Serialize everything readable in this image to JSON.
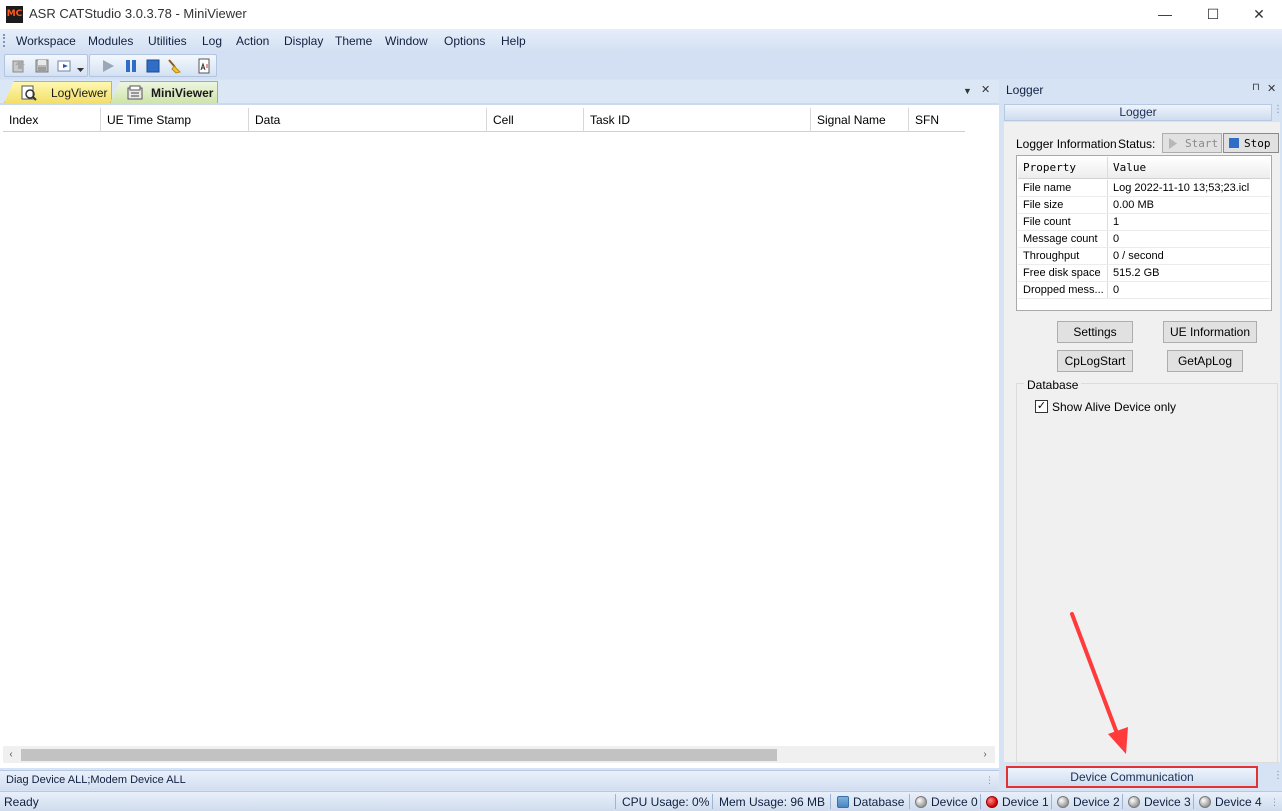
{
  "window": {
    "title": "ASR CATStudio 3.0.3.78 - MiniViewer",
    "logo_text": "MC",
    "minimize": "—",
    "maximize": "☐",
    "close": "✕"
  },
  "menu": {
    "items": [
      "Workspace",
      "Modules",
      "Utilities",
      "Log",
      "Action",
      "Display",
      "Theme",
      "Window",
      "Options",
      "Help"
    ]
  },
  "toolbar": {
    "icons": [
      "import-icon",
      "save-icon",
      "export-icon",
      "play-icon",
      "pause-icon",
      "stop-icon",
      "clear-icon",
      "report-icon"
    ]
  },
  "tabs": [
    {
      "label": "LogViewer",
      "active": false
    },
    {
      "label": "MiniViewer",
      "active": true
    }
  ],
  "pane_controls": {
    "dropdown": "▼",
    "close": "✕"
  },
  "grid": {
    "columns": [
      "Index",
      "UE Time Stamp",
      "Data",
      "Cell",
      "Task ID",
      "Signal Name",
      "SFN"
    ]
  },
  "scroll": {
    "left": "‹",
    "right": "›"
  },
  "status_line": "Diag Device ALL;Modem Device ALL",
  "logger": {
    "title": "Logger",
    "pin": "⊓",
    "close": "✕",
    "subhead": "Logger",
    "info_label": "Logger Information",
    "status_label": "Status:",
    "start_label": "Start",
    "stop_label": "Stop",
    "table_headers": [
      "Property",
      "Value"
    ],
    "rows": [
      {
        "property": "File name",
        "value": "Log 2022-11-10 13;53;23.icl"
      },
      {
        "property": "File size",
        "value": "0.00 MB"
      },
      {
        "property": "File count",
        "value": "1"
      },
      {
        "property": "Message count",
        "value": "0"
      },
      {
        "property": "Throughput",
        "value": "0 / second"
      },
      {
        "property": "Free disk space",
        "value": "515.2 GB"
      },
      {
        "property": "Dropped mess...",
        "value": "0"
      }
    ],
    "buttons": {
      "settings": "Settings",
      "ue_information": "UE Information",
      "cplogstart": "CpLogStart",
      "getaplog": "GetApLog"
    },
    "database_label": "Database",
    "show_alive_label": "Show Alive Device only",
    "show_alive_checked": true,
    "device_communication": "Device Communication"
  },
  "statusbar": {
    "ready": "Ready",
    "cpu": "CPU Usage:  0%",
    "mem": "Mem Usage: 96 MB",
    "database": "Database",
    "devices": [
      {
        "label": "Device 0",
        "status": "grey"
      },
      {
        "label": "Device 1",
        "status": "red"
      },
      {
        "label": "Device 2",
        "status": "grey"
      },
      {
        "label": "Device 3",
        "status": "grey"
      },
      {
        "label": "Device 4",
        "status": "grey"
      }
    ]
  },
  "colors": {
    "accent": "#d6e3f5",
    "highlight_border": "#e23232",
    "annotation_arrow": "#ff3b3b"
  }
}
